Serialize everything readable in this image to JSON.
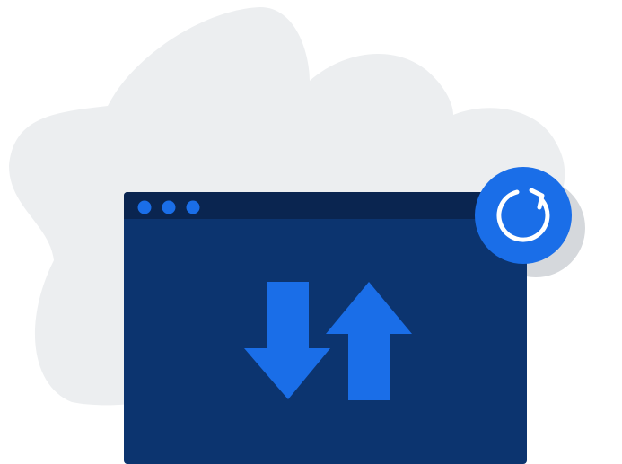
{
  "illustration": {
    "subject": "sync-transfer",
    "icons": [
      "cloud-icon",
      "browser-window-icon",
      "download-arrow-icon",
      "upload-arrow-icon",
      "refresh-icon"
    ]
  },
  "colors": {
    "background": "#ffffff",
    "cloud": "#eceef0",
    "cloud_shadow": "#d5d8dc",
    "window_body": "#0c346f",
    "window_titlebar": "#0a2550",
    "window_dots": "#1a6ee8",
    "arrows": "#1a6ee8",
    "refresh_badge": "#1a6ee8",
    "refresh_glyph": "#ffffff"
  },
  "window": {
    "titlebar_dot_count": 3
  }
}
